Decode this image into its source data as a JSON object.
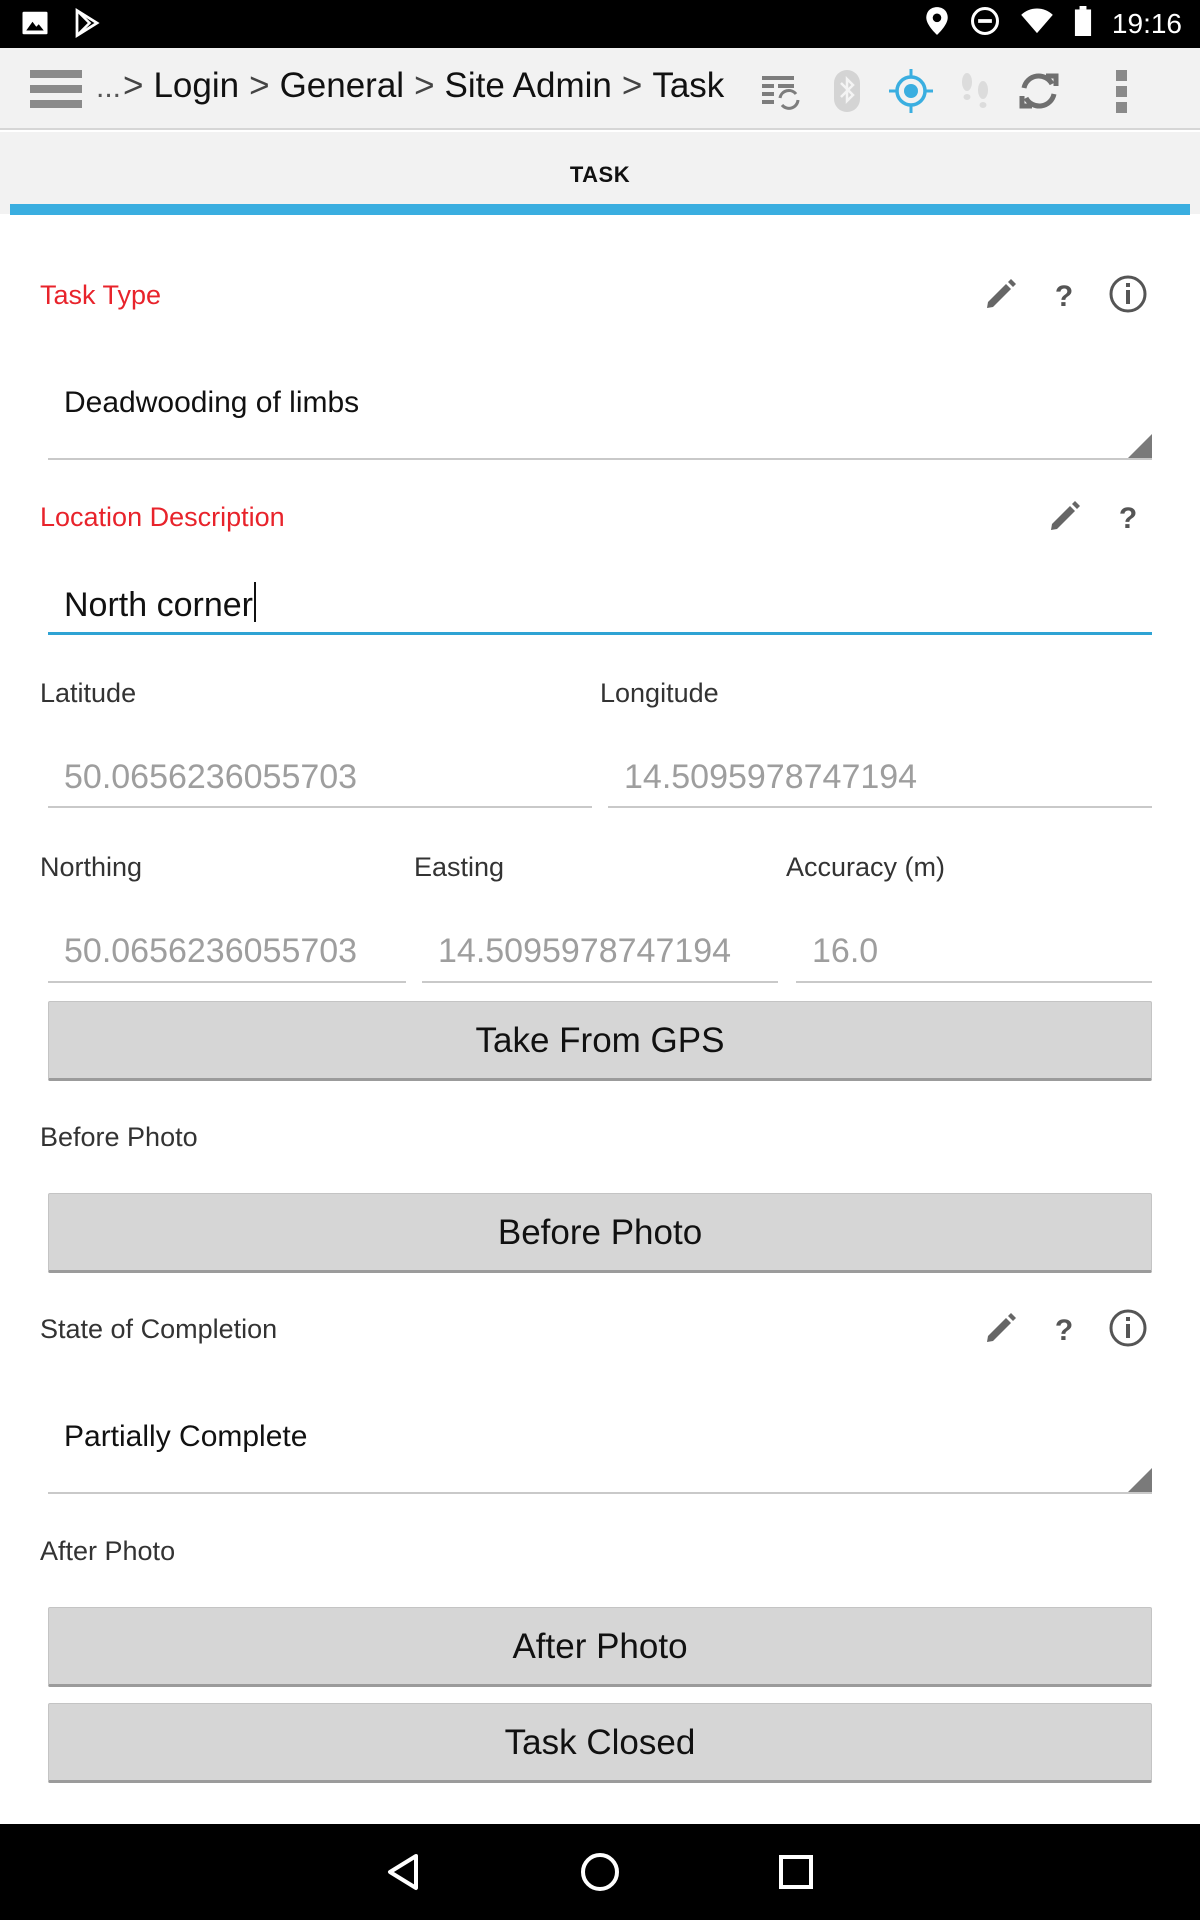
{
  "status_bar": {
    "time": "19:16",
    "left_icons": [
      "image-icon",
      "play-store-icon"
    ],
    "right_icons": [
      "location-icon",
      "do-not-disturb-icon",
      "wifi-icon",
      "battery-icon"
    ]
  },
  "toolbar": {
    "ellipsis": "...",
    "breadcrumb": [
      "Login",
      "General",
      "Site Admin",
      "Task"
    ],
    "separator": ">",
    "icons": [
      "sync-list-icon",
      "bluetooth-icon",
      "gps-target-icon",
      "footsteps-icon",
      "refresh-icon",
      "overflow-menu-icon"
    ],
    "gps_active_color": "#3aaee0"
  },
  "tab": {
    "label": "TASK"
  },
  "form": {
    "task_type": {
      "label": "Task Type",
      "value": "Deadwooding of limbs"
    },
    "location_description": {
      "label": "Location Description",
      "value": "North corner"
    },
    "latitude": {
      "label": "Latitude",
      "value": "50.0656236055703"
    },
    "longitude": {
      "label": "Longitude",
      "value": "14.5095978747194"
    },
    "northing": {
      "label": "Northing",
      "value": "50.0656236055703"
    },
    "easting": {
      "label": "Easting",
      "value": "14.5095978747194"
    },
    "accuracy": {
      "label": "Accuracy (m)",
      "value": "16.0"
    },
    "take_gps_button": "Take From GPS",
    "before_photo": {
      "label": "Before Photo",
      "button": "Before Photo"
    },
    "state_of_completion": {
      "label": "State of Completion",
      "value": "Partially Complete"
    },
    "after_photo": {
      "label": "After Photo",
      "button": "After Photo"
    },
    "task_closed_button": "Task Closed"
  },
  "colors": {
    "required_label": "#e8232b",
    "accent": "#3aaee0"
  },
  "nav_bar": {
    "icons": [
      "back-icon",
      "home-icon",
      "recents-icon"
    ]
  }
}
